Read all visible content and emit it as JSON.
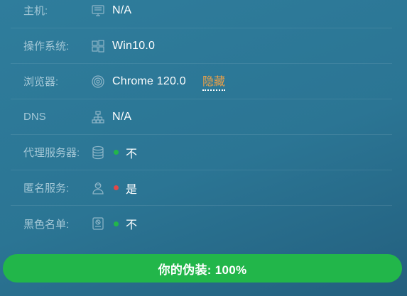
{
  "rows": [
    {
      "label": "主机:",
      "icon": "monitor-icon",
      "value": "N/A"
    },
    {
      "label": "操作系统:",
      "icon": "windows-icon",
      "value": "Win10.0"
    },
    {
      "label": "浏览器:",
      "icon": "browser-icon",
      "value": "Chrome 120.0",
      "action": "隐藏"
    },
    {
      "label": "DNS",
      "icon": "network-icon",
      "value": "N/A"
    },
    {
      "label": "代理服务器:",
      "icon": "database-icon",
      "value": "不",
      "status_color": "#22b64a"
    },
    {
      "label": "匿名服务:",
      "icon": "user-icon",
      "value": "是",
      "status_color": "#e04848"
    },
    {
      "label": "黑色名单:",
      "icon": "blacklist-icon",
      "value": "不",
      "status_color": "#22b64a"
    }
  ],
  "status_bar": {
    "text": "你的伪装: 100%",
    "percent": 100,
    "color": "#22b64a"
  },
  "colors": {
    "accent_link": "#e8a04a",
    "label": "#a3c7d6",
    "value": "#ffffff"
  }
}
